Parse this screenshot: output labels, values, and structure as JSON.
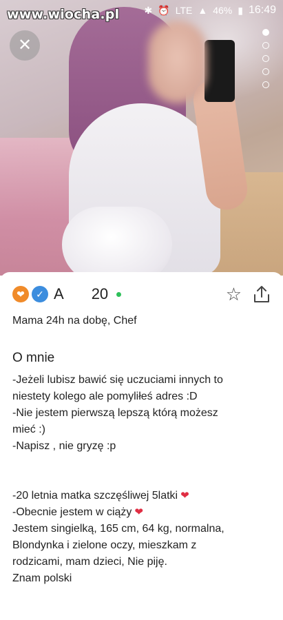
{
  "watermark": "www.wiocha.pl",
  "status_bar": {
    "battery": "46%",
    "network": "LTE",
    "time": "16:49"
  },
  "photo": {
    "pager_total": 5,
    "pager_active": 1
  },
  "profile": {
    "name": "A",
    "age": "20",
    "tagline": "Mama 24h na dobę, Chef",
    "about_title": "O mnie",
    "bio_lines": [
      "-Jeżeli lubisz bawić się uczuciami innych to",
      "niestety kolego ale pomyliłeś adres :D",
      "-Nie jestem pierwszą lepszą którą możesz",
      "mieć :)",
      "-Napisz , nie gryzę :p"
    ],
    "bio_lines_2": [
      "-20 letnia matka szczęśliwej 5latki",
      "-Obecnie jestem w ciąży",
      "Jestem singielką, 165 cm, 64 kg, normalna,",
      "Blondynka i zielone oczy, mieszkam z",
      "rodzicami, mam dzieci, Nie piję.",
      "Znam polski"
    ]
  },
  "colors": {
    "online": "#2ec05a",
    "heart": "#e02e43",
    "badge_orange": "#f08b2a",
    "badge_blue": "#3c8dde"
  }
}
